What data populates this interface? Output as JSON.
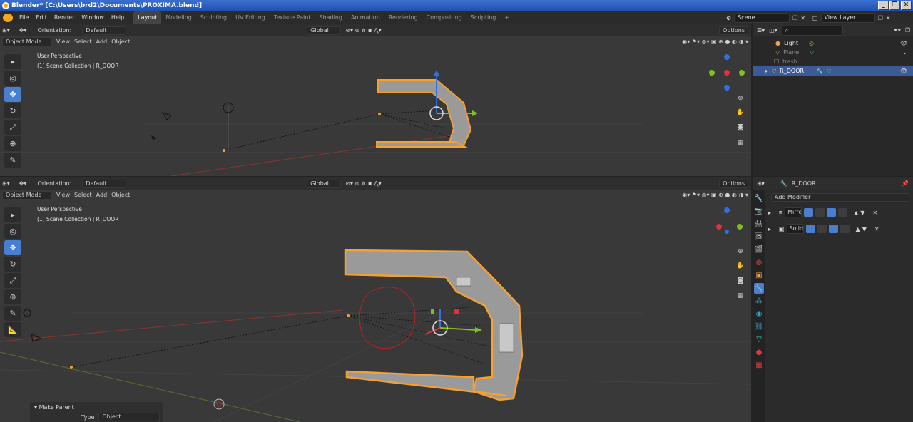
{
  "window": {
    "title": "Blender* [C:\\Users\\brd2\\Documents\\PROXIMA.blend]",
    "buttons": [
      "_",
      "❐",
      "✕"
    ]
  },
  "menu": [
    "File",
    "Edit",
    "Render",
    "Window",
    "Help"
  ],
  "workspaces": [
    "Layout",
    "Modeling",
    "Sculpting",
    "UV Editing",
    "Texture Paint",
    "Shading",
    "Animation",
    "Rendering",
    "Compositing",
    "Scripting",
    "+"
  ],
  "scene": {
    "scene_name": "Scene",
    "view_layer": "View Layer"
  },
  "viewport_header": {
    "orientation_label": "Orientation:",
    "orientation_value": "Default",
    "transform": "Global",
    "options": "Options",
    "mode": "Object Mode",
    "menus": [
      "View",
      "Select",
      "Add",
      "Object"
    ]
  },
  "viewport_top": {
    "perspective": "User Perspective",
    "collection": "(1) Scene Collection | R_DOOR"
  },
  "viewport_bottom": {
    "perspective": "User Perspective",
    "collection": "(1) Scene Collection | R_DOOR"
  },
  "outliner": {
    "items": [
      {
        "label": "Light",
        "color": "#f0a050"
      },
      {
        "label": "Plane",
        "color": "#888888"
      },
      {
        "label": "trash",
        "color": "#888888"
      },
      {
        "label": "R_DOOR",
        "color": "#ffffff",
        "selected": true
      }
    ]
  },
  "properties": {
    "object_name": "R_DOOR",
    "add_modifier": "Add Modifier",
    "modifiers": [
      {
        "name": "Mirro"
      },
      {
        "name": "Solidi"
      }
    ]
  },
  "make_parent": {
    "title": "Make Parent",
    "type_label": "Type",
    "type_value": "Object"
  },
  "colors": {
    "accent": "#4a7ecf",
    "selection": "#f5a030",
    "x_axis": "#e03040",
    "y_axis": "#80c020",
    "z_axis": "#3070e0"
  }
}
